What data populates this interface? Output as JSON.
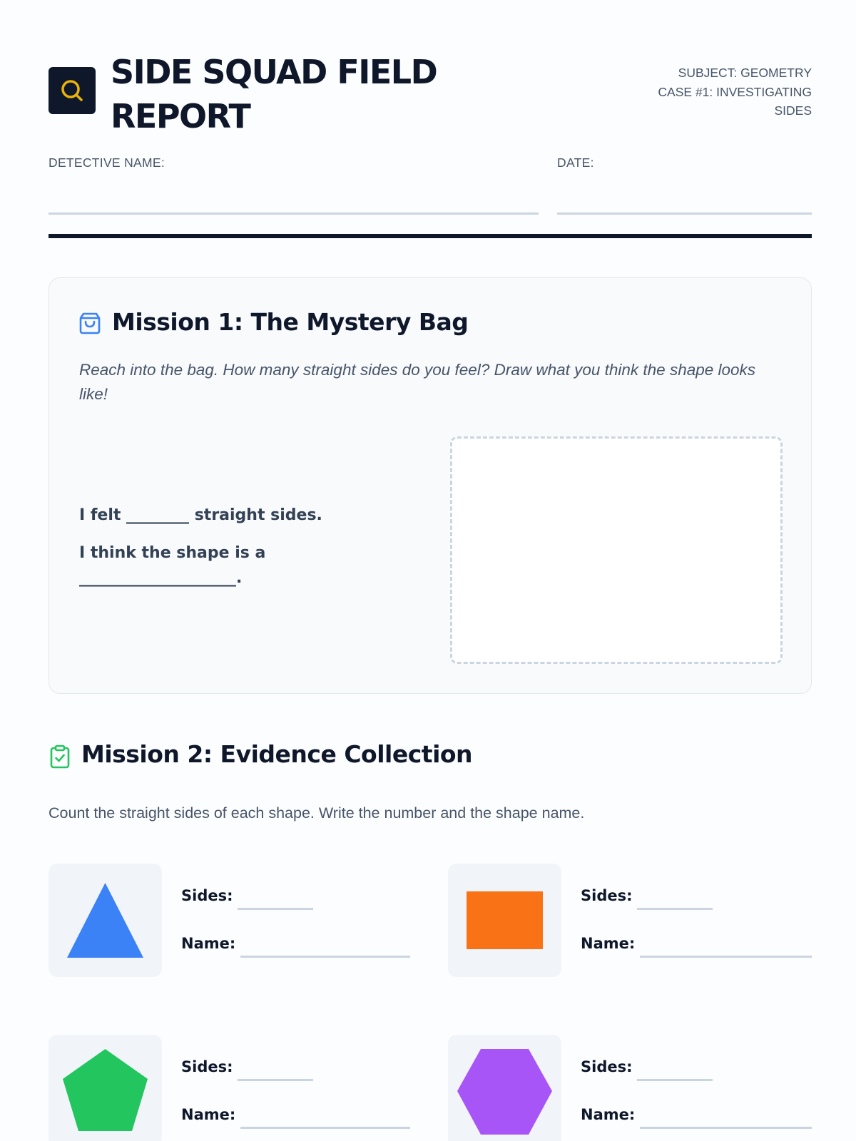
{
  "header": {
    "title": "SIDE SQUAD FIELD REPORT",
    "subject": "SUBJECT: GEOMETRY",
    "case_line1": "CASE #1: INVESTIGATING",
    "case_line2": "SIDES",
    "logo_icon": "search-icon"
  },
  "fields": {
    "detective_label": "DETECTIVE NAME:",
    "date_label": "DATE:"
  },
  "mission1": {
    "title": "Mission 1: The Mystery Bag",
    "icon": "shopping-bag-icon",
    "instructions": "Reach into the bag. How many straight sides do you feel? Draw what you think the shape looks like!",
    "line1": "I felt ________ straight sides.",
    "line2": "I think the shape is a",
    "line3": "____________________."
  },
  "mission2": {
    "title": "Mission 2: Evidence Collection",
    "icon": "clipboard-check-icon",
    "instructions": "Count the straight sides of each shape. Write the number and the shape name.",
    "sides_label": "Sides:",
    "name_label": "Name:",
    "shapes": [
      {
        "shape": "triangle",
        "color": "#3b82f6"
      },
      {
        "shape": "rectangle",
        "color": "#f97316"
      },
      {
        "shape": "pentagon",
        "color": "#22c55e"
      },
      {
        "shape": "hexagon",
        "color": "#a855f7"
      }
    ]
  },
  "colors": {
    "ink": "#0f172a",
    "muted": "#475569",
    "line": "#cbd5e1",
    "logo_accent": "#eab308",
    "mission1_icon": "#3b82f6",
    "mission2_icon": "#22c55e"
  }
}
